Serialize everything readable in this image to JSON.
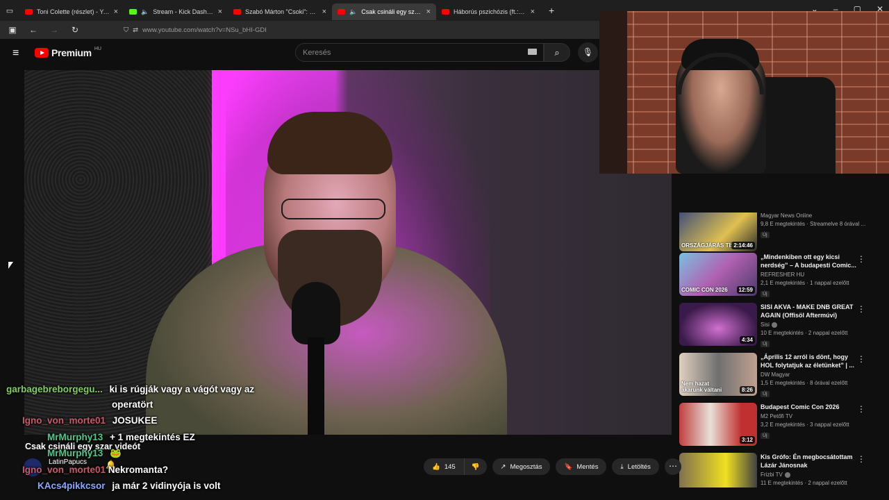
{
  "browser": {
    "tabs": [
      {
        "label": "Toni Colette (részlet) - YouTube",
        "favicon": "youtube",
        "active": false
      },
      {
        "label": "Stream - Kick Dashboard",
        "favicon": "kick",
        "active": false
      },
      {
        "label": "Szabó Márton \"Csoki\": a Kutyap",
        "favicon": "youtube",
        "active": false
      },
      {
        "label": "Csak csináli egy szar videót",
        "favicon": "youtube",
        "active": true
      },
      {
        "label": "Háborús pszichózis (ft.: Peti) -",
        "favicon": "youtube",
        "active": false
      }
    ],
    "new_tab": "+",
    "url": "www.youtube.com/watch?v=NSu_bHI-GDI"
  },
  "youtube": {
    "logo_text": "Premium",
    "logo_country": "HU",
    "search_placeholder": "Keresés",
    "video_title": "Csak csináli egy szar videót",
    "channel_name": "LatinPapucs",
    "actions": {
      "like_count": "145",
      "share_label": "Megosztás",
      "save_label": "Mentés",
      "download_label": "Letöltés"
    },
    "related": [
      {
        "title": "",
        "channel": "Magyar News Online",
        "views": "9,8 E megtekintés · Streamelve 8 órával ...",
        "badge": "Új",
        "duration": "2:14:46",
        "thumb_text": "ORSZÁGJÁRÁS TISZAÚJ",
        "thumb_color": "#2a3b5a"
      },
      {
        "title": "„Mindenkiben ott egy kicsi nerdség” – A budapesti Comic...",
        "channel": "REFRESHER HU",
        "views": "2,1 E megtekintés · 1 nappal ezelőtt",
        "badge": "Új",
        "duration": "12:59",
        "thumb_text": "COMIC CON 2026",
        "thumb_color": "#6a5a8c"
      },
      {
        "title": "SISI AKVA - MAKE DNB GREAT AGAIN (Offisöl Aftermúvi)",
        "channel": "Sisi",
        "views": "10 E megtekintés · 2 nappal ezelőtt",
        "badge": "Új",
        "duration": "4:34",
        "thumb_text": "",
        "thumb_color": "#4a2a5a"
      },
      {
        "title": "„Április 12 arról is dönt, hogy HOL folytatjuk az életünket” | ...",
        "channel": "DW Magyar",
        "views": "1,5 E megtekintés · 8 órával ezelőtt",
        "badge": "Új",
        "duration": "8:26",
        "thumb_text": "Nem hazat akarunk váltani",
        "thumb_color": "#5a5a5a"
      },
      {
        "title": "Budapest Comic Con 2026",
        "channel": "M2 Petőfi TV",
        "views": "3,2 E megtekintés · 3 nappal ezelőtt",
        "badge": "Új",
        "duration": "3:12",
        "thumb_text": "",
        "thumb_color": "#a04040"
      },
      {
        "title": "Kis Grófo: Én megbocsátottam Lázár Jánosnak",
        "channel": "Frizbi TV",
        "views": "11 E megtekintés · 2 nappal ezelőtt",
        "badge": "",
        "duration": "",
        "thumb_text": "",
        "thumb_color": "#6a6a3a"
      }
    ]
  },
  "chat": [
    {
      "nick": "garbagebreborgegu...",
      "text": "ki is rúgják vagy a vágót vagy az",
      "nick_color": "#7fcf5a"
    },
    {
      "nick": "",
      "text": "operatört",
      "nick_color": "#ffffff"
    },
    {
      "nick": "Igno_von_morte01",
      "text": "JOSUKEE",
      "nick_color": "#c85a6a"
    },
    {
      "nick": "MrMurphy13",
      "text": "+ 1 megtekintés EZ",
      "nick_color": "#4ec98a"
    },
    {
      "nick": "MrMurphy13",
      "text": "🐸",
      "nick_color": "#4ec98a"
    },
    {
      "nick": "Igno_von_morte01",
      "text": "Nekromanta?",
      "nick_color": "#c85a6a"
    },
    {
      "nick": "KAcs4pikkcsor",
      "text": "ja már 2 vidinyója is volt",
      "nick_color": "#8aa8ff"
    }
  ]
}
